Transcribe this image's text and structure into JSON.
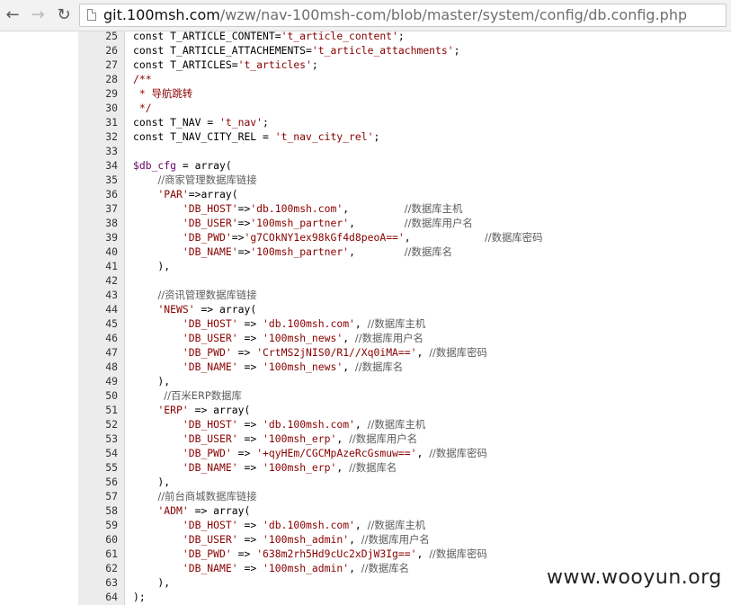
{
  "browser": {
    "url_host": "git.100msh.com",
    "url_path": "/wzw/nav-100msh-com/blob/master/system/config/db.config.php",
    "icons": {
      "back": "back-arrow-icon",
      "forward": "forward-arrow-icon",
      "reload": "reload-icon",
      "page": "page-icon"
    }
  },
  "code": {
    "lines": [
      {
        "n": "25",
        "t": "const T_ARTICLE_CONTENT='t_article_content';"
      },
      {
        "n": "26",
        "t": "const T_ARTICLE_ATTACHEMENTS='t_article_attachments';"
      },
      {
        "n": "27",
        "t": "const T_ARTICLES='t_articles';"
      },
      {
        "n": "28",
        "t": "/**"
      },
      {
        "n": "29",
        "t": " * 导航跳转"
      },
      {
        "n": "30",
        "t": " */"
      },
      {
        "n": "31",
        "t": "const T_NAV = 't_nav';"
      },
      {
        "n": "32",
        "t": "const T_NAV_CITY_REL = 't_nav_city_rel';"
      },
      {
        "n": "33",
        "t": ""
      },
      {
        "n": "34",
        "t": "$db_cfg = array("
      },
      {
        "n": "35",
        "t": "    //商家管理数据库链接"
      },
      {
        "n": "36",
        "t": "    'PAR'=>array("
      },
      {
        "n": "37",
        "t": "        'DB_HOST'=>'db.100msh.com',         //数据库主机"
      },
      {
        "n": "38",
        "t": "        'DB_USER'=>'100msh_partner',        //数据库用户名"
      },
      {
        "n": "39",
        "t": "        'DB_PWD'=>'g7COkNY1ex98kGf4d8peoA==',            //数据库密码"
      },
      {
        "n": "40",
        "t": "        'DB_NAME'=>'100msh_partner',        //数据库名"
      },
      {
        "n": "41",
        "t": "    ),"
      },
      {
        "n": "42",
        "t": ""
      },
      {
        "n": "43",
        "t": "    //资讯管理数据库链接"
      },
      {
        "n": "44",
        "t": "    'NEWS' => array("
      },
      {
        "n": "45",
        "t": "        'DB_HOST' => 'db.100msh.com', //数据库主机"
      },
      {
        "n": "46",
        "t": "        'DB_USER' => '100msh_news', //数据库用户名"
      },
      {
        "n": "47",
        "t": "        'DB_PWD' => 'CrtMS2jNIS0/R1//Xq0iMA==', //数据库密码"
      },
      {
        "n": "48",
        "t": "        'DB_NAME' => '100msh_news', //数据库名"
      },
      {
        "n": "49",
        "t": "    ),"
      },
      {
        "n": "50",
        "t": "     //百米ERP数据库"
      },
      {
        "n": "51",
        "t": "    'ERP' => array("
      },
      {
        "n": "52",
        "t": "        'DB_HOST' => 'db.100msh.com', //数据库主机"
      },
      {
        "n": "53",
        "t": "        'DB_USER' => '100msh_erp', //数据库用户名"
      },
      {
        "n": "54",
        "t": "        'DB_PWD' => '+qyHEm/CGCMpAzeRcGsmuw==', //数据库密码"
      },
      {
        "n": "55",
        "t": "        'DB_NAME' => '100msh_erp', //数据库名"
      },
      {
        "n": "56",
        "t": "    ),"
      },
      {
        "n": "57",
        "t": "    //前台商城数据库链接"
      },
      {
        "n": "58",
        "t": "    'ADM' => array("
      },
      {
        "n": "59",
        "t": "        'DB_HOST' => 'db.100msh.com', //数据库主机"
      },
      {
        "n": "60",
        "t": "        'DB_USER' => '100msh_admin', //数据库用户名"
      },
      {
        "n": "61",
        "t": "        'DB_PWD' => '638m2rh5Hd9cUc2xDjW3Ig==', //数据库密码"
      },
      {
        "n": "62",
        "t": "        'DB_NAME' => '100msh_admin', //数据库名"
      },
      {
        "n": "63",
        "t": "    ),"
      },
      {
        "n": "64",
        "t": ");"
      }
    ]
  },
  "watermark": "www.wooyun.org"
}
